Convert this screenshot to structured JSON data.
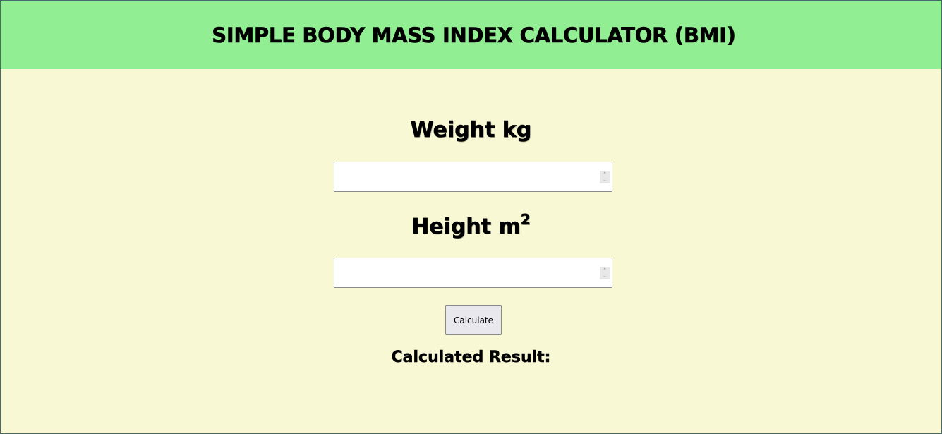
{
  "header": {
    "title": "SIMPLE BODY MASS INDEX CALCULATOR (BMI)"
  },
  "form": {
    "weight_label": "Weight kg",
    "weight_value": "",
    "height_label": "Height m",
    "height_sup": "2",
    "height_value": "",
    "calculate_label": "Calculate"
  },
  "result": {
    "label": "Calculated Result:",
    "value": ""
  },
  "colors": {
    "header_bg": "#92ee92",
    "page_bg": "#f8f8d4",
    "button_bg": "#e9e8ec"
  },
  "icons": {
    "spinner": "spinner-arrows-icon"
  }
}
